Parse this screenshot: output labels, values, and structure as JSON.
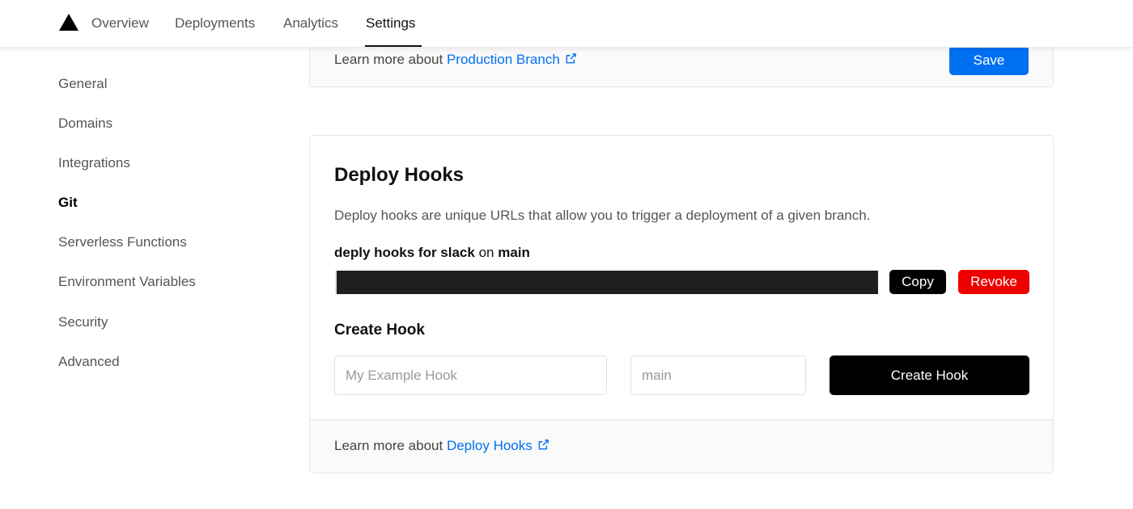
{
  "nav": {
    "logo": "triangle-logo-icon",
    "tabs": [
      {
        "label": "Overview",
        "active": false
      },
      {
        "label": "Deployments",
        "active": false
      },
      {
        "label": "Analytics",
        "active": false
      },
      {
        "label": "Settings",
        "active": true
      }
    ]
  },
  "sidebar": {
    "items": [
      {
        "label": "General",
        "active": false
      },
      {
        "label": "Domains",
        "active": false
      },
      {
        "label": "Integrations",
        "active": false
      },
      {
        "label": "Git",
        "active": true
      },
      {
        "label": "Serverless Functions",
        "active": false
      },
      {
        "label": "Environment Variables",
        "active": false
      },
      {
        "label": "Security",
        "active": false
      },
      {
        "label": "Advanced",
        "active": false
      }
    ]
  },
  "production_branch_card": {
    "learn_prefix": "Learn more about",
    "learn_link": "Production Branch",
    "save_label": "Save"
  },
  "deploy_hooks": {
    "title": "Deploy Hooks",
    "description": "Deploy hooks are unique URLs that allow you to trigger a deployment of a given branch.",
    "hook": {
      "name": "deply hooks for slack",
      "on": "on",
      "branch": "main",
      "url": "",
      "copy_label": "Copy",
      "revoke_label": "Revoke"
    },
    "create": {
      "title": "Create Hook",
      "name_placeholder": "My Example Hook",
      "branch_placeholder": "main",
      "button_label": "Create Hook"
    },
    "footer": {
      "learn_prefix": "Learn more about",
      "learn_link": "Deploy Hooks"
    }
  },
  "colors": {
    "accent": "#0070f3",
    "danger": "#ee0000",
    "primary_button": "#000000",
    "muted_text": "#555555"
  }
}
